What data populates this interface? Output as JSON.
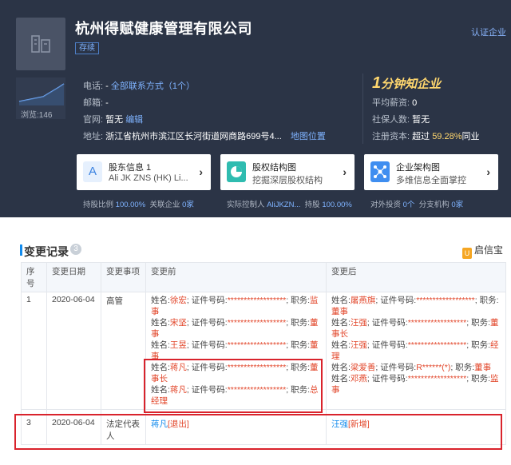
{
  "company": {
    "name": "杭州得赋健康管理有限公司",
    "status": "存续",
    "verify": "认证企业",
    "views": "浏览:146"
  },
  "info": {
    "phone_label": "电话:",
    "phone_value": "-",
    "phone_link": "全部联系方式（1个）",
    "email_label": "邮箱:",
    "email_value": "-",
    "site_label": "官网:",
    "site_value": "暂无",
    "site_link": "编辑",
    "addr_label": "地址:",
    "addr_value": "浙江省杭州市滨江区长河街道网商路699号4...",
    "addr_link": "地图位置"
  },
  "right_info": {
    "slogan_num": "1",
    "slogan_text": "分钟知企业",
    "salary_label": "平均薪资:",
    "salary_value": "0",
    "insured_label": "社保人数:",
    "insured_value": "暂无",
    "capital_label": "注册资本:",
    "capital_pre": "超过",
    "capital_pct": "59.28%",
    "capital_post": "同业"
  },
  "cards": [
    {
      "title": "股东信息 1",
      "subtitle": "Ali JK ZNS (HK) Li...",
      "icon": "A",
      "foot_label": "持股比例",
      "foot_value": "100.00%",
      "foot_label2": "关联企业",
      "foot_value2": "0家"
    },
    {
      "title": "股权结构图",
      "subtitle": "挖掘深层股权结构",
      "icon": "pie-chart-icon",
      "foot_label": "实际控制人",
      "foot_value": "AliJKZN...",
      "foot_label2": "持股",
      "foot_value2": "100.00%"
    },
    {
      "title": "企业架构图",
      "subtitle": "多维信息全面掌控",
      "icon": "network-icon",
      "foot_label": "对外投资",
      "foot_value": "0个",
      "foot_label2": "分支机构",
      "foot_value2": "0家"
    }
  ],
  "changes": {
    "title": "变更记录",
    "count": "3",
    "brand": "启信宝",
    "brand_mark": "U",
    "headers": [
      "序号",
      "变更日期",
      "变更事项",
      "变更前",
      "变更后"
    ],
    "row1": {
      "no": "1",
      "date": "2020-06-04",
      "item": "高管",
      "before": [
        [
          "姓名:",
          "徐宏",
          "; 证件号码:",
          "******************",
          "; 职务:",
          "监事"
        ],
        [
          "姓名:",
          "宋坚",
          "; 证件号码:",
          "******************",
          "; 职务:",
          "董事"
        ],
        [
          "姓名:",
          "王昱",
          "; 证件号码:",
          "******************",
          "; 职务:",
          "董事"
        ],
        [
          "姓名:",
          "蒋凡",
          "; 证件号码:",
          "******************",
          "; 职务:",
          "董事长"
        ],
        [
          "姓名:",
          "蒋凡",
          "; 证件号码:",
          "******************",
          "; 职务:",
          "总经理"
        ]
      ],
      "after": [
        [
          "姓名:",
          "屠燕旗",
          "; 证件号码:",
          "******************",
          "; 职务:",
          "董事"
        ],
        [
          "姓名:",
          "汪强",
          "; 证件号码:",
          "******************",
          "; 职务:",
          "董事长"
        ],
        [
          "姓名:",
          "汪强",
          "; 证件号码:",
          "******************",
          "; 职务:",
          "经理"
        ],
        [
          "姓名:",
          "梁爱善",
          "; 证件号码:",
          "R******(*)",
          "; 职务:",
          "董事"
        ],
        [
          "姓名:",
          "邓燕",
          "; 证件号码:",
          "******************",
          "; 职务:",
          "监事"
        ]
      ]
    },
    "row3": {
      "no": "3",
      "date": "2020-06-04",
      "item": "法定代表人",
      "before_name": "蒋凡",
      "before_tag": "[退出]",
      "after_name": "汪强",
      "after_tag": "[新增]"
    }
  }
}
